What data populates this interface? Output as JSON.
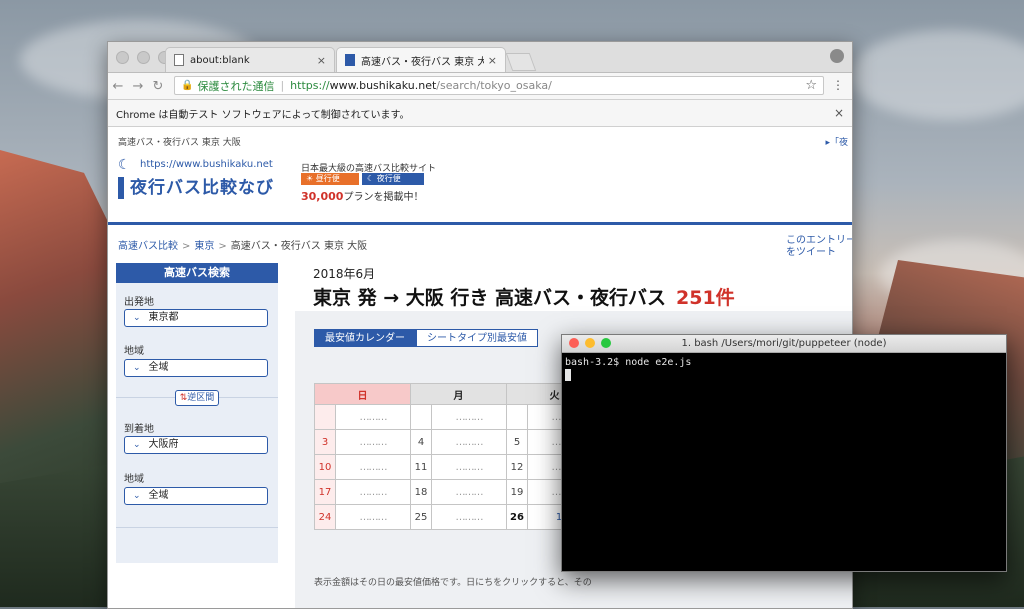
{
  "browser": {
    "tabs": [
      {
        "title": "about:blank"
      },
      {
        "title": "高速バス・夜行バス 東京 大阪 最安"
      }
    ],
    "tab_close": "×",
    "address": {
      "secure_label": "保護された通信",
      "separator": "|",
      "scheme": "https://",
      "host": "www.bushikaku.net",
      "path": "/search/tokyo_osaka/"
    },
    "infobar": {
      "text": "Chrome は自動テスト ソフトウェアによって制御されています。",
      "close": "×"
    }
  },
  "site": {
    "topline": "高速バス・夜行バス 東京 大阪",
    "topright": "▸「夜",
    "logo_url": "https://www.bushikaku.net",
    "logo_brand": "夜行バス比較なび",
    "tagline": "日本最大級の高速バス比較サイト",
    "day_label": "☀ 昼行便",
    "night_label": "☾ 夜行便",
    "plans_count": "30,000",
    "plans_suffix": "プランを掲載中！",
    "breadcrumbs": [
      "高速バス比較",
      "東京",
      "高速バス・夜行バス 東京 大阪"
    ],
    "crumb_sep": ">",
    "tweet": "このエントリーをツイート"
  },
  "sidebar": {
    "title": "高速バス検索",
    "departure_label": "出発地",
    "departure_value": "東京都",
    "area1_label": "地域",
    "area1_value": "全域",
    "swap_label": "逆区間",
    "arrival_label": "到着地",
    "arrival_value": "大阪府",
    "area2_label": "地域",
    "area2_value": "全域"
  },
  "main": {
    "month": "2018年6月",
    "headline": "東京 発 → 大阪 行き 高速バス・夜行バス",
    "count": "251件",
    "tab_calendar": "最安値カレンダー",
    "tab_seat": "シートタイプ別最安値",
    "days": [
      "日",
      "月",
      "火"
    ],
    "placeholder": "………",
    "rows": [
      {
        "sun": "",
        "mon": "",
        "tue": ""
      },
      {
        "sun": "3",
        "mon": "4",
        "tue": "5"
      },
      {
        "sun": "10",
        "mon": "11",
        "tue": "12"
      },
      {
        "sun": "17",
        "mon": "18",
        "tue": "19"
      },
      {
        "sun": "24",
        "mon": "25",
        "tue": "26",
        "tue_price": "1,60"
      }
    ],
    "note": "表示金額はその日の最安値価格です。日にちをクリックすると、その"
  },
  "terminal": {
    "title": "1. bash  /Users/mori/git/puppeteer (node)",
    "prompt": "bash-3.2$ node e2e.js"
  }
}
